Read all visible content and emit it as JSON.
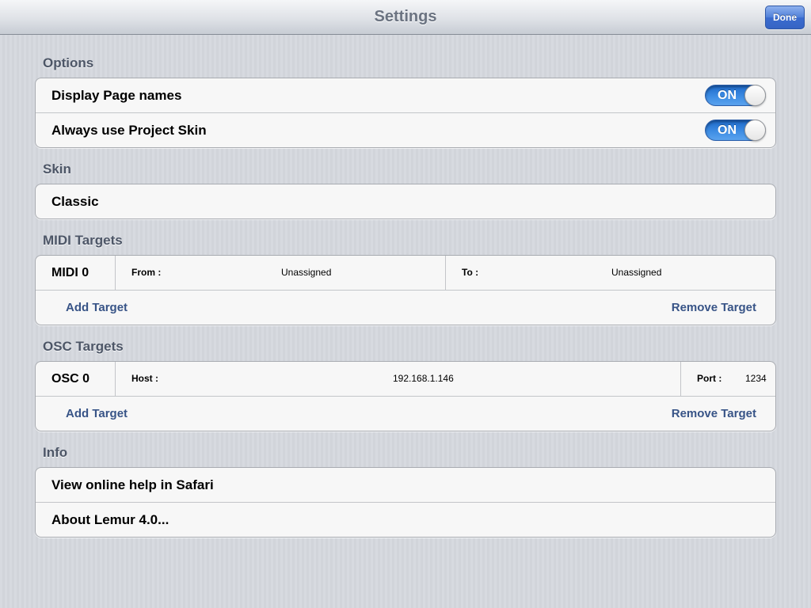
{
  "navbar": {
    "title": "Settings",
    "done_label": "Done"
  },
  "options": {
    "header": "Options",
    "items": [
      {
        "label": "Display Page names",
        "toggle": "ON"
      },
      {
        "label": "Always use Project Skin",
        "toggle": "ON"
      }
    ]
  },
  "skin": {
    "header": "Skin",
    "value": "Classic"
  },
  "midi": {
    "header": "MIDI Targets",
    "target": {
      "name": "MIDI 0",
      "from_label": "From :",
      "from_value": "Unassigned",
      "to_label": "To :",
      "to_value": "Unassigned"
    },
    "add_label": "Add Target",
    "remove_label": "Remove Target"
  },
  "osc": {
    "header": "OSC Targets",
    "target": {
      "name": "OSC 0",
      "host_label": "Host :",
      "host_value": "192.168.1.146",
      "port_label": "Port :",
      "port_value": "1234"
    },
    "add_label": "Add Target",
    "remove_label": "Remove Target"
  },
  "info": {
    "header": "Info",
    "items": [
      {
        "label": "View online help in Safari"
      },
      {
        "label": "About Lemur 4.0..."
      }
    ]
  },
  "colors": {
    "accent_blue": "#3d8ce3",
    "link_blue": "#385487",
    "section_header": "#4d5667"
  }
}
